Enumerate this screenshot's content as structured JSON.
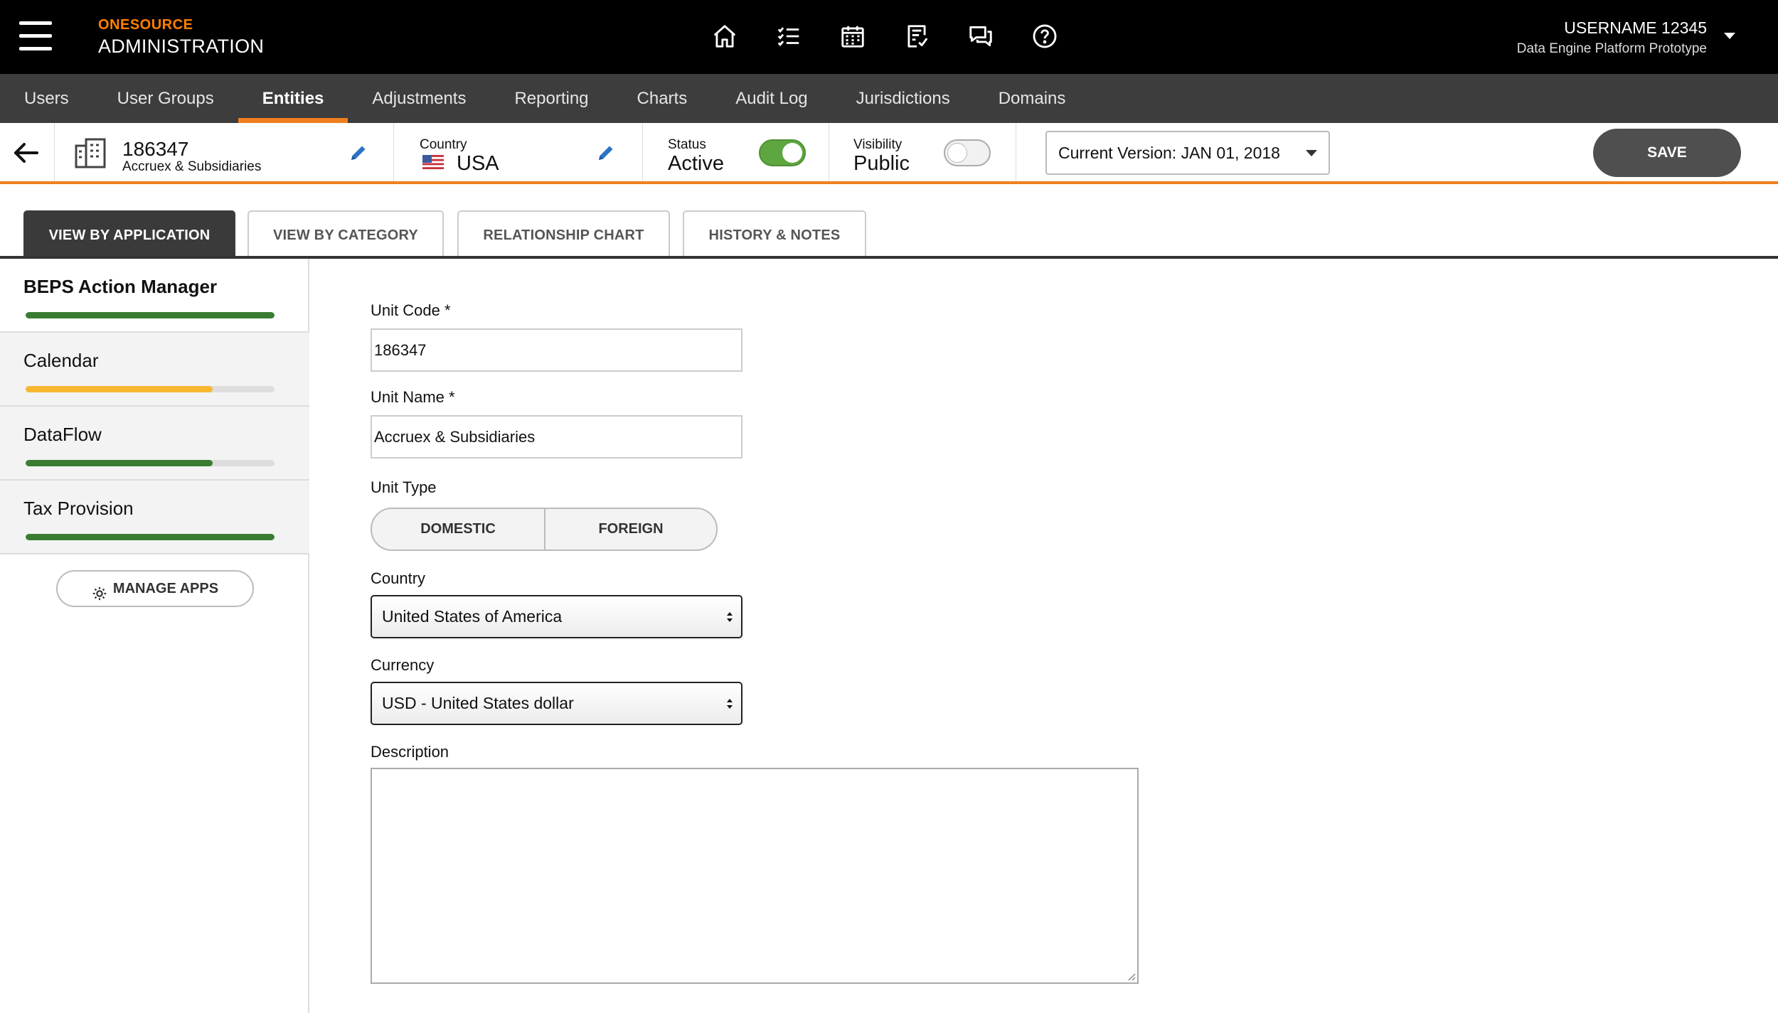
{
  "header": {
    "brand_top": "ONESOURCE",
    "brand_bottom": "ADMINISTRATION",
    "username": "USERNAME 12345",
    "subtitle": "Data Engine Platform Prototype",
    "icons": [
      "home-icon",
      "tasks-icon",
      "calendar-icon",
      "checklist-icon",
      "chat-icon",
      "help-icon"
    ]
  },
  "nav": {
    "items": [
      "Users",
      "User Groups",
      "Entities",
      "Adjustments",
      "Reporting",
      "Charts",
      "Audit Log",
      "Jurisdictions",
      "Domains"
    ],
    "active": "Entities"
  },
  "entity": {
    "id": "186347",
    "name": "Accruex & Subsidiaries",
    "country_label": "Country",
    "country_value": "USA",
    "status_label": "Status",
    "status_value": "Active",
    "status_on": true,
    "visibility_label": "Visibility",
    "visibility_value": "Public",
    "visibility_on": false,
    "version": "Current Version: JAN 01, 2018",
    "save_label": "SAVE"
  },
  "tabs": [
    "VIEW BY APPLICATION",
    "VIEW BY CATEGORY",
    "RELATIONSHIP CHART",
    "HISTORY & NOTES"
  ],
  "sidebar": {
    "apps": [
      {
        "name": "BEPS Action Manager",
        "progress": 1.0,
        "color": "#3a7d32"
      },
      {
        "name": "Calendar",
        "progress": 0.75,
        "color": "#f7b731"
      },
      {
        "name": "DataFlow",
        "progress": 0.75,
        "color": "#3a7d32"
      },
      {
        "name": "Tax Provision",
        "progress": 1.0,
        "color": "#3a7d32"
      }
    ],
    "manage_label": "MANAGE APPS"
  },
  "form": {
    "unit_code_label": "Unit Code *",
    "unit_code_value": "186347",
    "unit_name_label": "Unit Name *",
    "unit_name_value": "Accruex & Subsidiaries",
    "unit_type_label": "Unit Type",
    "unit_type_options": [
      "DOMESTIC",
      "FOREIGN"
    ],
    "country_label": "Country",
    "country_value": "United States of America",
    "currency_label": "Currency",
    "currency_value": "USD - United States dollar",
    "description_label": "Description",
    "description_value": ""
  }
}
